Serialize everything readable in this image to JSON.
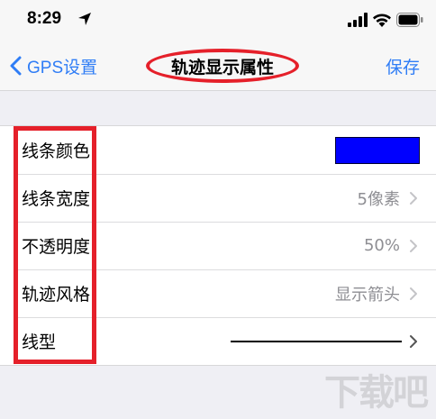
{
  "status_bar": {
    "time": "8:29"
  },
  "nav": {
    "back_label": "GPS设置",
    "title": "轨迹显示属性",
    "save_label": "保存",
    "accent_color": "#2f7df6",
    "highlight_color": "#e5202a"
  },
  "settings": {
    "rows": [
      {
        "label": "线条颜色",
        "value": "",
        "swatch_color": "#0000ff"
      },
      {
        "label": "线条宽度",
        "value": "5像素"
      },
      {
        "label": "不透明度",
        "value": "50%"
      },
      {
        "label": "轨迹风格",
        "value": "显示箭头"
      },
      {
        "label": "线型",
        "value": ""
      }
    ]
  },
  "watermark": {
    "text": "下载吧"
  },
  "icons": [
    "location-arrow-icon",
    "signal-icon",
    "wifi-icon",
    "battery-icon",
    "chevron-left-icon",
    "chevron-right-icon"
  ]
}
